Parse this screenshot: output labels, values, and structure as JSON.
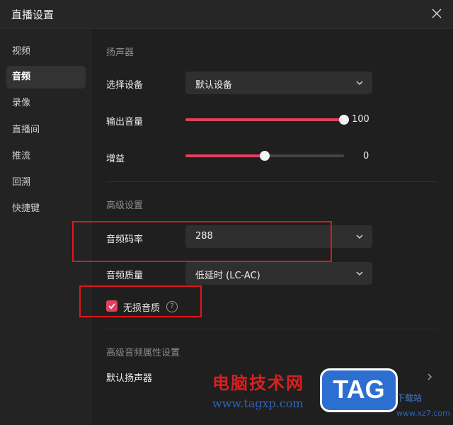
{
  "window": {
    "title": "直播设置"
  },
  "sidebar": {
    "items": [
      {
        "label": "视频"
      },
      {
        "label": "音频"
      },
      {
        "label": "录像"
      },
      {
        "label": "直播间"
      },
      {
        "label": "推流"
      },
      {
        "label": "回溯"
      },
      {
        "label": "快捷键"
      }
    ],
    "active_index": 1
  },
  "speaker": {
    "section_label": "扬声器",
    "device_label": "选择设备",
    "device_value": "默认设备",
    "volume_label": "输出音量",
    "volume_value": "100",
    "volume_level": 1.0,
    "gain_label": "增益",
    "gain_value": "0",
    "gain_level": 0.5
  },
  "advanced": {
    "section_label": "高级设置",
    "bitrate_label": "音频码率",
    "bitrate_value": "288",
    "quality_label": "音频质量",
    "quality_value": "低延时 (LC-AC)",
    "lossless_label": "无损音质",
    "lossless_checked": true,
    "help_glyph": "?"
  },
  "advanced_props": {
    "section_label": "高级音频属性设置",
    "default_speaker_label": "默认扬声器"
  },
  "watermark": {
    "site_name": "电脑技术网",
    "site_url": "www.tagxp.com",
    "tag_text": "TAG",
    "right_text": "下载站",
    "right_url": "www.xz7.com"
  },
  "colors": {
    "accent": "#e0405f",
    "highlight_box": "#e0161b"
  }
}
